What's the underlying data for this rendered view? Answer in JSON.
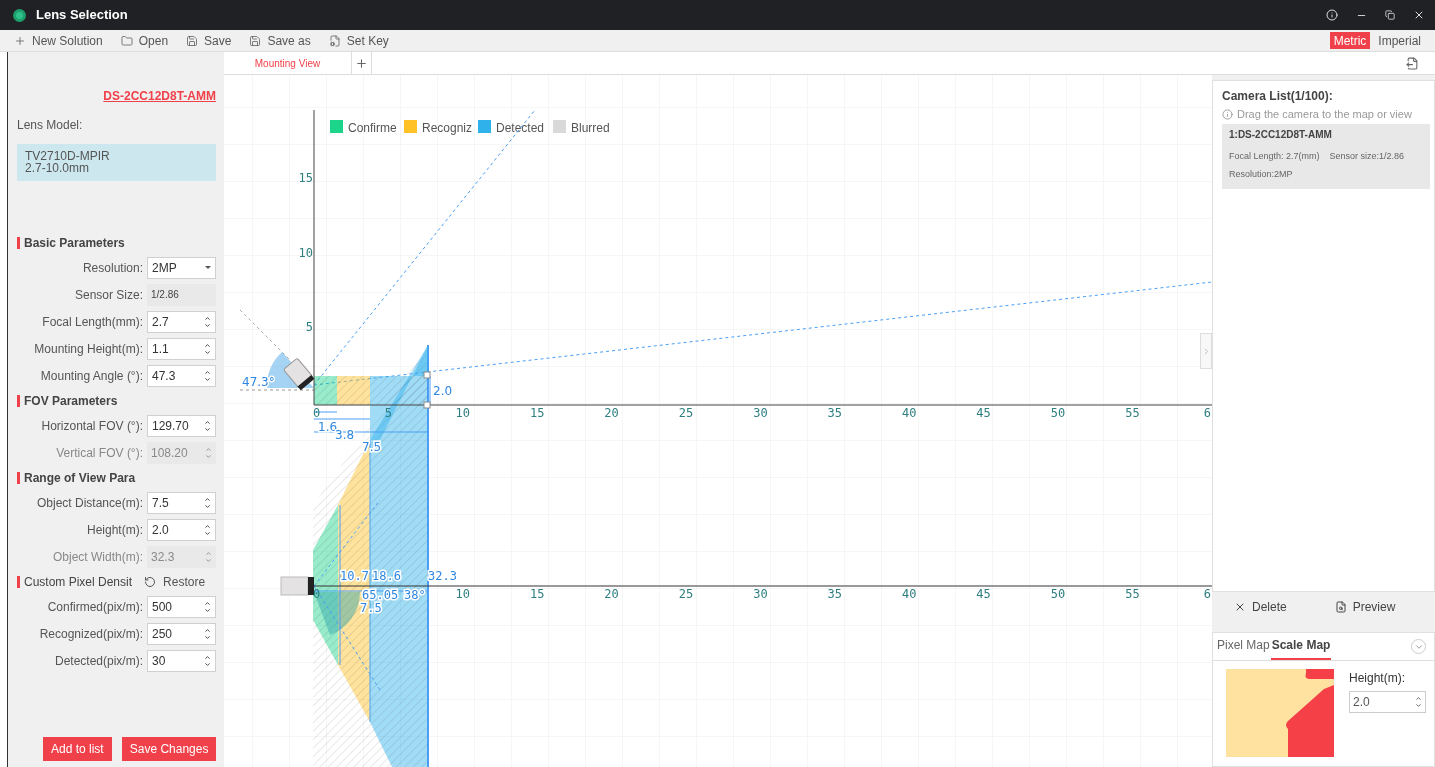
{
  "window": {
    "title": "Lens Selection"
  },
  "toolbar": {
    "items": [
      "New Solution",
      "Open",
      "Save",
      "Save as",
      "Set Key"
    ],
    "units": [
      {
        "label": "Metric",
        "selected": true
      },
      {
        "label": "Imperial",
        "selected": false
      }
    ]
  },
  "left_panel": {
    "camera_model": "DS-2CC12D8T-AMM",
    "lens_model_label": "Lens Model:",
    "lens_model": [
      "TV2710D-MPIR",
      "2.7-10.0mm"
    ],
    "sections": [
      {
        "title": "Basic Parameters",
        "bold": true,
        "fields": [
          {
            "label": "Resolution:",
            "value": "2MP",
            "kind": "select",
            "disabled": false
          },
          {
            "label": "Sensor Size:",
            "value": "1/2.86",
            "kind": "static",
            "disabled": true
          },
          {
            "label": "Focal Length(mm):",
            "value": "2.7",
            "kind": "spin",
            "disabled": false
          },
          {
            "label": "Mounting Height(m):",
            "value": "1.1",
            "kind": "spin",
            "disabled": false
          },
          {
            "label": "Mounting Angle (°):",
            "value": "47.3",
            "kind": "spin",
            "disabled": false
          }
        ]
      },
      {
        "title": "FOV Parameters",
        "bold": true,
        "fields": [
          {
            "label": "Horizontal FOV (°):",
            "value": "129.70",
            "kind": "spin",
            "disabled": false
          },
          {
            "label": "Vertical FOV (°):",
            "value": "108.20",
            "kind": "spin",
            "disabled": true
          }
        ]
      },
      {
        "title": "Range of View Para",
        "bold": true,
        "fields": [
          {
            "label": "Object Distance(m):",
            "value": "7.5",
            "kind": "spin",
            "disabled": false
          },
          {
            "label": "Height(m):",
            "value": "2.0",
            "kind": "spin",
            "disabled": false
          },
          {
            "label": "Object Width(m):",
            "value": "32.3",
            "kind": "spin",
            "disabled": true
          }
        ]
      },
      {
        "title": "Custom Pixel Densit",
        "bold": false,
        "action": "Restore",
        "fields": [
          {
            "label": "Confirmed(pix/m):",
            "value": "500",
            "kind": "spin",
            "disabled": false
          },
          {
            "label": "Recognized(pix/m):",
            "value": "250",
            "kind": "spin",
            "disabled": false
          },
          {
            "label": "Detected(pix/m):",
            "value": "30",
            "kind": "spin",
            "disabled": false
          }
        ]
      }
    ],
    "buttons": [
      "Add to list",
      "Save Changes"
    ]
  },
  "tabs": [
    {
      "label": "Mounting View",
      "selected": true
    }
  ],
  "diagram": {
    "legend": [
      {
        "label": "Confirme",
        "color": "#1dd48b"
      },
      {
        "label": "Recogniz",
        "color": "#ffc125"
      },
      {
        "label": "Detected",
        "color": "#2fb1ec"
      },
      {
        "label": "Blurred",
        "color": "#d9d9d9"
      }
    ],
    "side_view": {
      "x_ticks": [
        "0",
        "5",
        "10",
        "15",
        "20",
        "25",
        "30",
        "35",
        "40",
        "45",
        "50",
        "55",
        "6"
      ],
      "y_ticks": [
        "15",
        "10",
        "5"
      ],
      "labels": [
        "47.3°",
        "2.0",
        "1.6",
        "3.8",
        "7.5"
      ]
    },
    "top_view": {
      "x_ticks": [
        "0",
        "10",
        "15",
        "20",
        "25",
        "30",
        "35",
        "40",
        "45",
        "50",
        "55",
        "6"
      ],
      "labels": [
        "10.7",
        "18.6",
        "32.3",
        "65.05",
        "38°",
        "7.5"
      ]
    }
  },
  "camera_list": {
    "title": "Camera List(1/100):",
    "hint": "Drag the camera to the map or view",
    "cameras": [
      {
        "name": "1:DS-2CC12D8T-AMM",
        "focal_length": "Focal Length: 2.7(mm)",
        "sensor_size": "Sensor size:1/2.86",
        "resolution": "Resolution:2MP",
        "selected": true
      }
    ],
    "actions": [
      "Delete",
      "Preview"
    ]
  },
  "map_panel": {
    "tabs": [
      {
        "label": "Pixel Map",
        "selected": false
      },
      {
        "label": "Scale Map",
        "selected": true
      }
    ],
    "height_label": "Height(m):",
    "height_value": "2.0"
  }
}
